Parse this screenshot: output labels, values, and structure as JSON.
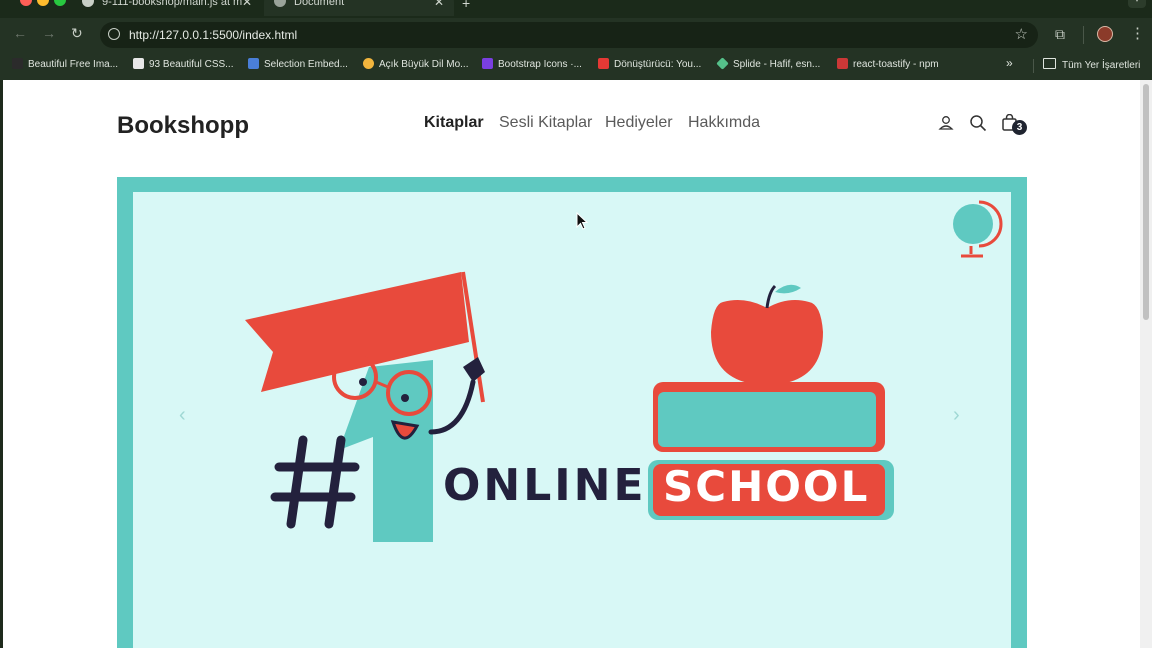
{
  "browser": {
    "tabs": [
      {
        "title": "9-111-bookshop/main.js at m"
      },
      {
        "title": "Document"
      }
    ],
    "new_tab": "+",
    "url": "http://127.0.0.1:5500/index.html",
    "bookmarks": [
      {
        "label": "Beautiful Free Ima...",
        "color": "#2b2b2b"
      },
      {
        "label": "93 Beautiful CSS...",
        "color": "#e8e8e8"
      },
      {
        "label": "Selection Embed...",
        "color": "#4a7fd8"
      },
      {
        "label": "Açık Büyük Dil Mo...",
        "color": "#f2b53d"
      },
      {
        "label": "Bootstrap Icons ·...",
        "color": "#7a3fe0"
      },
      {
        "label": "Dönüştürücü: You...",
        "color": "#e53935"
      },
      {
        "label": "Splide - Hafif, esn...",
        "color": "#55c08a"
      },
      {
        "label": "react-toastify - npm",
        "color": "#cb3837"
      }
    ],
    "bookmarks_more": "»",
    "all_bookmarks": "Tüm Yer İşaretleri"
  },
  "site": {
    "brand": "Bookshopp",
    "nav": [
      {
        "label": "Kitaplar",
        "active": true
      },
      {
        "label": "Sesli Kitaplar",
        "active": false
      },
      {
        "label": "Hediyeler",
        "active": false
      },
      {
        "label": "Hakkımda",
        "active": false
      }
    ],
    "cart_count": "3",
    "icons": [
      "user-icon",
      "search-icon",
      "shopping-bag-icon"
    ]
  },
  "hero": {
    "number_text": "#1",
    "word_online": "ONLINE",
    "word_school": "SCHOOL",
    "colors": {
      "frame": "#5fc9c1",
      "background": "#d8f8f6",
      "red": "#e84a3c",
      "navy": "#23213d",
      "teal": "#5fc9c1"
    }
  }
}
